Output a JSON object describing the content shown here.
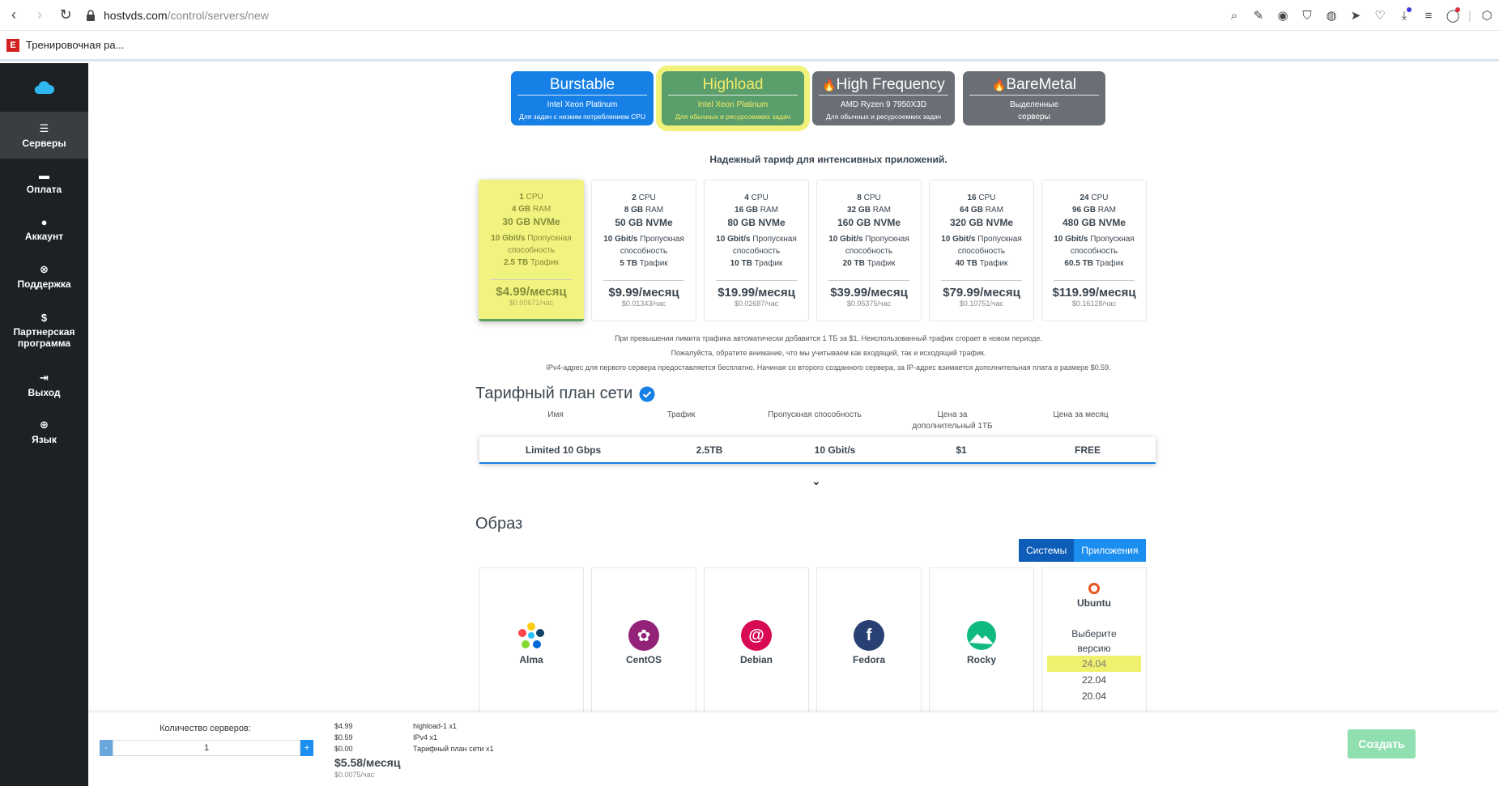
{
  "browser": {
    "url_host": "hostvds.com",
    "url_path": "/control/servers/new",
    "bookmark": "Тренировочная ра..."
  },
  "sidebar": {
    "items": [
      {
        "label": "Серверы",
        "icon": "servers-icon"
      },
      {
        "label": "Оплата",
        "icon": "card-icon"
      },
      {
        "label": "Аккаунт",
        "icon": "user-icon"
      },
      {
        "label": "Поддержка",
        "icon": "support-icon"
      },
      {
        "label": "Партнерская программа",
        "icon": "dollar-icon"
      },
      {
        "label": "Выход",
        "icon": "logout-icon"
      },
      {
        "label": "Язык",
        "icon": "globe-icon"
      }
    ]
  },
  "plans": [
    {
      "title": "Burstable",
      "sub": "Intel Xeon Platinum",
      "desc": "Для задач с низким потреблением CPU",
      "fire": false
    },
    {
      "title": "Highload",
      "sub": "Intel Xeon Platinum",
      "desc": "Для обычных и ресурсоемких задач",
      "fire": false
    },
    {
      "title": "High Frequency",
      "sub": "AMD Ryzen 9 7950X3D",
      "desc": "Для обычных и ресурсоемких задач",
      "fire": true
    },
    {
      "title": "BareMetal",
      "sub": "Выделенные",
      "desc": "серверы",
      "fire": true
    }
  ],
  "plan_headline": "Надежный тариф для интенсивных приложений.",
  "units": {
    "cpu": "CPU",
    "ram": "RAM",
    "bandwidth_label": "Пропускная",
    "bandwidth_label2": "способность",
    "traffic": "Трафик"
  },
  "tariffs": [
    {
      "cpu": "1",
      "ram": "4 GB",
      "disk": "30 GB NVMe",
      "speed": "10 Gbit/s",
      "traffic": "2.5 TB",
      "price": "$4.99/месяц",
      "hour": "$0.00671/час"
    },
    {
      "cpu": "2",
      "ram": "8 GB",
      "disk": "50 GB NVMe",
      "speed": "10 Gbit/s",
      "traffic": "5 TB",
      "price": "$9.99/месяц",
      "hour": "$0.01343/час"
    },
    {
      "cpu": "4",
      "ram": "16 GB",
      "disk": "80 GB NVMe",
      "speed": "10 Gbit/s",
      "traffic": "10 TB",
      "price": "$19.99/месяц",
      "hour": "$0.02687/час"
    },
    {
      "cpu": "8",
      "ram": "32 GB",
      "disk": "160 GB NVMe",
      "speed": "10 Gbit/s",
      "traffic": "20 TB",
      "price": "$39.99/месяц",
      "hour": "$0.05375/час"
    },
    {
      "cpu": "16",
      "ram": "64 GB",
      "disk": "320 GB NVMe",
      "speed": "10 Gbit/s",
      "traffic": "40 TB",
      "price": "$79.99/месяц",
      "hour": "$0.10751/час"
    },
    {
      "cpu": "24",
      "ram": "96 GB",
      "disk": "480 GB NVMe",
      "speed": "10 Gbit/s",
      "traffic": "60.5 TB",
      "price": "$119.99/месяц",
      "hour": "$0.16128/час"
    }
  ],
  "notes": [
    "При превышении лимита трафика автоматически добавится 1 ТБ за $1. Неиспользованный трафик сгорает в новом периоде.",
    "Пожалуйста, обратите внимание, что мы учитываем как входящий, так и исходящий трафик.",
    "IPv4-адрес для первого сервера предоставляется бесплатно. Начиная со второго созданного сервера, за IP-адрес взимается дополнительная плата в размере $0.59."
  ],
  "network": {
    "title": "Тарифный план сети",
    "headers": [
      "Имя",
      "Трафик",
      "Пропускная способность",
      "Цена за дополнительный 1ТБ",
      "Цена за месяц"
    ],
    "row": [
      "Limited 10 Gbps",
      "2.5TB",
      "10 Gbit/s",
      "$1",
      "FREE"
    ]
  },
  "image": {
    "title": "Образ",
    "tabs": [
      "Системы",
      "Приложения"
    ],
    "os": [
      {
        "name": "Alma",
        "color": "#e94e3d"
      },
      {
        "name": "CentOS",
        "color": "#932279"
      },
      {
        "name": "Debian",
        "color": "#d70a53"
      },
      {
        "name": "Fedora",
        "color": "#294172"
      },
      {
        "name": "Rocky",
        "color": "#10b981"
      }
    ],
    "ubuntu": {
      "name": "Ubuntu",
      "prompt1": "Выберите",
      "prompt2": "версию",
      "versions": [
        "24.04",
        "22.04",
        "20.04"
      ]
    }
  },
  "footer": {
    "qty_label": "Количество серверов:",
    "qty_value": "1",
    "minus": "-",
    "plus": "+",
    "lines": [
      {
        "price": "$4.99",
        "item": "highload-1 x1"
      },
      {
        "price": "$0.59",
        "item": "IPv4 x1"
      },
      {
        "price": "$0.00",
        "item": "Тарифный план сети x1"
      }
    ],
    "total": "$5.58/месяц",
    "total_hour": "$0.0075/час",
    "create": "Создать"
  },
  "colors": {
    "accent": "#1680e6",
    "highlight": "#f0f37e",
    "sidebar": "#1e2124",
    "create": "#8fdfb1"
  }
}
